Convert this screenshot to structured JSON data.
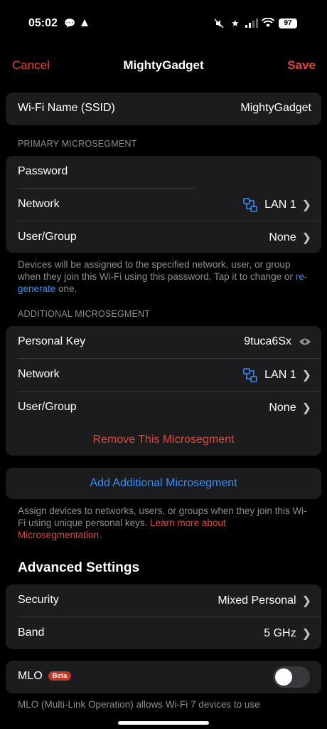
{
  "status_bar": {
    "time": "05:02",
    "battery": "97"
  },
  "nav": {
    "cancel": "Cancel",
    "title": "MightyGadget",
    "save": "Save"
  },
  "ssid": {
    "label": "Wi-Fi Name (SSID)",
    "value": "MightyGadget"
  },
  "primary": {
    "header": "PRIMARY MICROSEGMENT",
    "password_label": "Password",
    "network_label": "Network",
    "network_value": "LAN 1",
    "usergroup_label": "User/Group",
    "usergroup_value": "None",
    "footer_text": "Devices will be assigned to the specified network, user, or group when they join this Wi-Fi using this password. Tap it to change or ",
    "footer_link": "re-generate",
    "footer_end": " one."
  },
  "additional": {
    "header": "ADDITIONAL MICROSEGMENT",
    "key_label": "Personal Key",
    "key_value": "9tuca6Sx",
    "network_label": "Network",
    "network_value": "LAN 1",
    "usergroup_label": "User/Group",
    "usergroup_value": "None",
    "remove": "Remove This Microsegment"
  },
  "add_button": "Add Additional Microsegment",
  "add_footer": {
    "text": "Assign devices to networks, users, or groups when they join this Wi-Fi using unique personal keys. ",
    "link": "Learn more about Microsegmentation."
  },
  "advanced": {
    "title": "Advanced Settings",
    "security_label": "Security",
    "security_value": "Mixed Personal",
    "band_label": "Band",
    "band_value": "5 GHz"
  },
  "mlo": {
    "label": "MLO",
    "badge": "Beta",
    "enabled": false,
    "footer": "MLO (Multi-Link Operation) allows Wi-Fi 7 devices to use"
  },
  "colors": {
    "accent_red": "#e0483b",
    "link_blue": "#3a8ef5",
    "card_bg": "#1c1c1e"
  }
}
